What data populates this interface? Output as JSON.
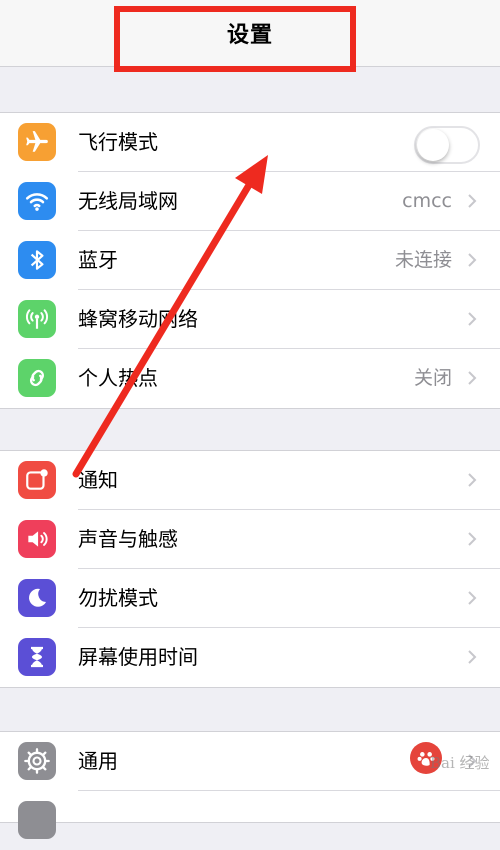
{
  "header": {
    "title": "设置"
  },
  "groups": [
    {
      "rows": [
        {
          "label": "飞行模式",
          "value": "",
          "icon": "airplane-icon",
          "icon_color": "#f7a033",
          "control": "toggle",
          "toggle_on": false
        },
        {
          "label": "无线局域网",
          "value": "cmcc",
          "icon": "wifi-icon",
          "icon_color": "#2d8cf0"
        },
        {
          "label": "蓝牙",
          "value": "未连接",
          "icon": "bluetooth-icon",
          "icon_color": "#2d8cf0"
        },
        {
          "label": "蜂窝移动网络",
          "value": "",
          "icon": "antenna-icon",
          "icon_color": "#5dd36a"
        },
        {
          "label": "个人热点",
          "value": "关闭",
          "icon": "hotspot-icon",
          "icon_color": "#5dd36a"
        }
      ]
    },
    {
      "rows": [
        {
          "label": "通知",
          "value": "",
          "icon": "notification-icon",
          "icon_color": "#f04c42"
        },
        {
          "label": "声音与触感",
          "value": "",
          "icon": "speaker-icon",
          "icon_color": "#ef3f5b"
        },
        {
          "label": "勿扰模式",
          "value": "",
          "icon": "moon-icon",
          "icon_color": "#5b4fd6"
        },
        {
          "label": "屏幕使用时间",
          "value": "",
          "icon": "hourglass-icon",
          "icon_color": "#5b4fd6"
        }
      ]
    },
    {
      "rows": [
        {
          "label": "通用",
          "value": "",
          "icon": "gear-icon",
          "icon_color": "#8e8e93"
        }
      ]
    }
  ],
  "colors": {
    "highlight": "#ee2a1f",
    "arrow": "#ee2a1f"
  },
  "watermark": {
    "text": "Bai 经验"
  }
}
